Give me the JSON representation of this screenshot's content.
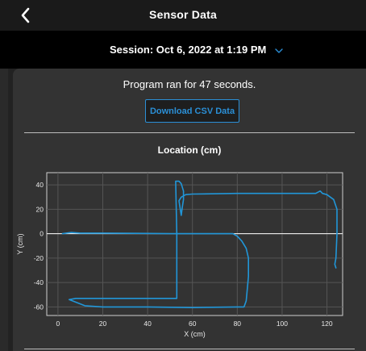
{
  "header": {
    "title": "Sensor Data",
    "back_icon": "chevron-left-icon"
  },
  "session": {
    "label": "Session: Oct 6, 2022 at 1:19 PM",
    "dropdown_icon": "chevron-down-icon",
    "accent": "#2b8fd6"
  },
  "summary": {
    "run_text": "Program ran for 47 seconds."
  },
  "actions": {
    "download_label": "Download CSV Data"
  },
  "chart_data": {
    "type": "line",
    "title": "Location (cm)",
    "xlabel": "X (cm)",
    "ylabel": "Y (cm)",
    "xlim": [
      -5,
      127
    ],
    "ylim": [
      -67,
      50
    ],
    "xticks": [
      "0",
      "20",
      "40",
      "60",
      "80",
      "100",
      "120"
    ],
    "yticks": [
      "40",
      "20",
      "0",
      "-20",
      "-40",
      "-60"
    ],
    "xtick_values": [
      0,
      20,
      40,
      60,
      80,
      100,
      120
    ],
    "ytick_values": [
      40,
      20,
      0,
      -20,
      -40,
      -60
    ],
    "grid": true,
    "line_color": "#2196d8",
    "series": [
      {
        "x": [
          2,
          6,
          10,
          20,
          35,
          50,
          60,
          70,
          78,
          80,
          82,
          84,
          85,
          85,
          84.5,
          84,
          83,
          80,
          60,
          40,
          20,
          12,
          5,
          8,
          20,
          53,
          53,
          53,
          52.5,
          54,
          55,
          55.5,
          56,
          56,
          55.5,
          55,
          54,
          55,
          57,
          60,
          80,
          100,
          115,
          117,
          118,
          120,
          123,
          124.5,
          124.5,
          124,
          123.5,
          124
        ],
        "y": [
          0,
          1,
          0.5,
          0.5,
          0.3,
          0,
          0,
          0,
          0,
          -2,
          -6,
          -12,
          -20,
          -35,
          -45,
          -55,
          -60,
          -60,
          -60.5,
          -60,
          -60,
          -59,
          -54,
          -53,
          -53,
          -53,
          -30,
          0,
          43,
          43,
          41,
          38,
          35,
          28,
          22,
          15,
          27,
          30,
          32,
          32.5,
          33,
          33,
          33,
          35,
          33,
          32,
          28,
          20,
          0,
          -20,
          -25,
          -28
        ]
      }
    ]
  }
}
